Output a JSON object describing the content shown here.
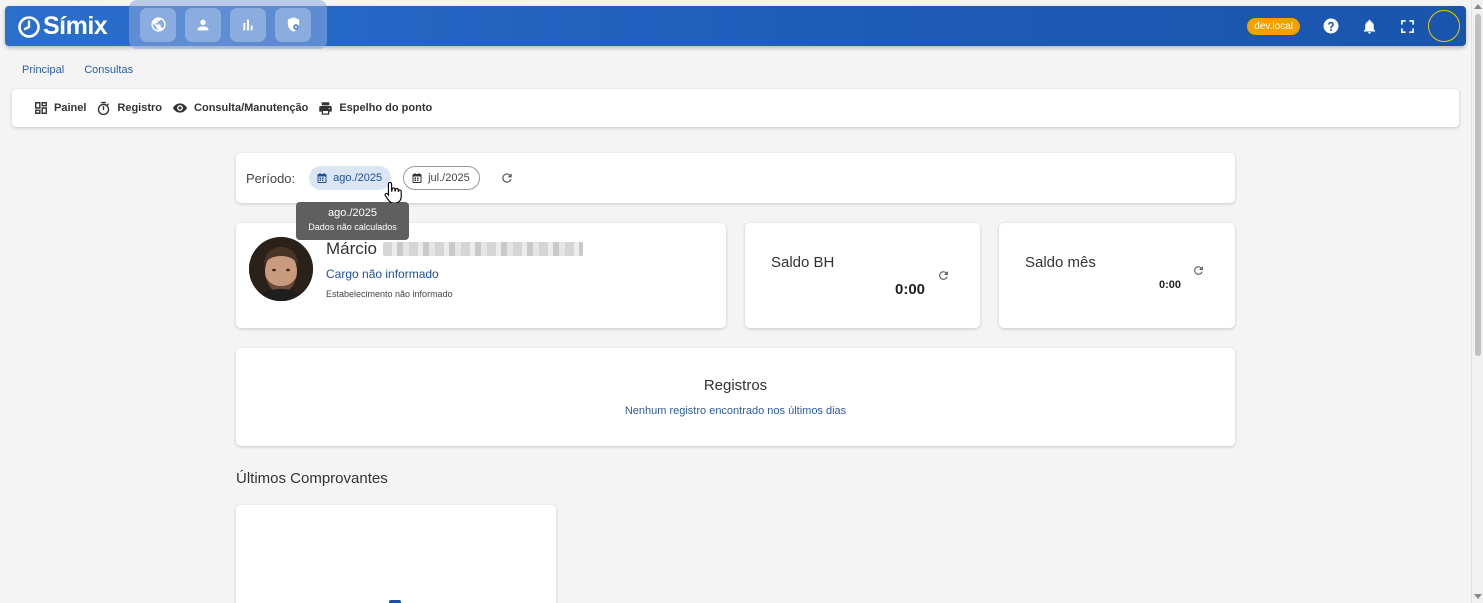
{
  "appbar": {
    "brand": "Símix",
    "modules": [
      "globe-icon",
      "user-icon",
      "bar-chart-icon",
      "shield-icon"
    ],
    "environment": "dev.local",
    "tools": [
      "help-icon",
      "bell-icon",
      "fullscreen-icon"
    ]
  },
  "tabs": [
    "Principal",
    "Consultas"
  ],
  "toolbar": {
    "painel": "Painel",
    "registro": "Registro",
    "consulta": "Consulta/Manutenção",
    "espelho": "Espelho do ponto"
  },
  "period": {
    "label": "Período:",
    "current": "ago./2025",
    "previous": "jul./2025"
  },
  "tooltip": {
    "title": "ago./2025",
    "subtitle": "Dados não calculados"
  },
  "profile": {
    "first_name": "Márcio",
    "role": "Cargo não informado",
    "establishment": "Estabelecimento não informado"
  },
  "saldo_bh": {
    "title": "Saldo BH",
    "value": "0:00"
  },
  "saldo_mes": {
    "title": "Saldo mês",
    "value": "0:00"
  },
  "registros": {
    "title": "Registros",
    "empty": "Nenhum registro encontrado nos últimos dias"
  },
  "ultimos": {
    "title": "Últimos Comprovantes"
  },
  "colors": {
    "primary": "#1d5bb8",
    "accent": "#f5a000",
    "link": "#2b5ca8"
  }
}
